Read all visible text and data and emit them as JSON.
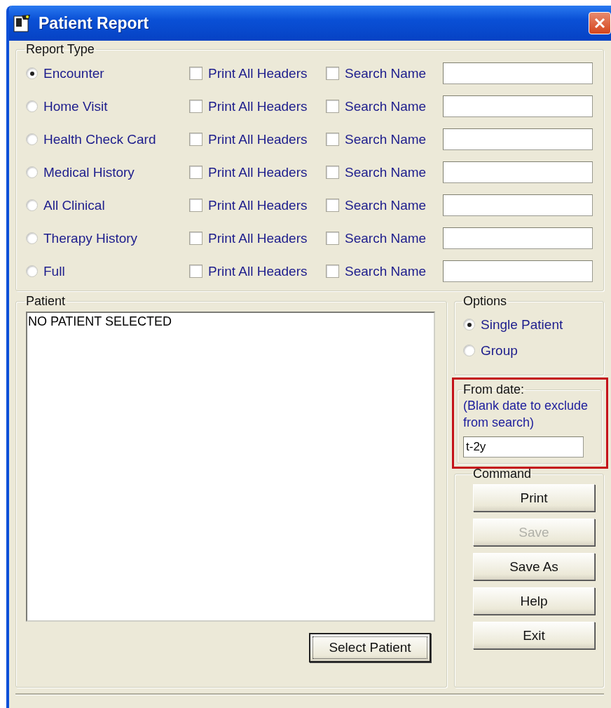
{
  "window": {
    "title": "Patient Report"
  },
  "report_type": {
    "label": "Report Type",
    "rows": [
      {
        "label": "Encounter",
        "selected": true,
        "print_all_headers": {
          "label": "Print All Headers",
          "checked": false
        },
        "search_name": {
          "label": "Search Name",
          "checked": false
        }
      },
      {
        "label": "Home Visit",
        "selected": false,
        "print_all_headers": {
          "label": "Print All Headers",
          "checked": false
        },
        "search_name": {
          "label": "Search Name",
          "checked": false
        }
      },
      {
        "label": "Health Check Card",
        "selected": false,
        "print_all_headers": {
          "label": "Print All Headers",
          "checked": false
        },
        "search_name": {
          "label": "Search Name",
          "checked": false
        }
      },
      {
        "label": "Medical History",
        "selected": false,
        "print_all_headers": {
          "label": "Print All Headers",
          "checked": false
        },
        "search_name": {
          "label": "Search Name",
          "checked": false
        }
      },
      {
        "label": "All Clinical",
        "selected": false,
        "print_all_headers": {
          "label": "Print All Headers",
          "checked": false
        },
        "search_name": {
          "label": "Search Name",
          "checked": false
        }
      },
      {
        "label": "Therapy History",
        "selected": false,
        "print_all_headers": {
          "label": "Print All Headers",
          "checked": false
        },
        "search_name": {
          "label": "Search Name",
          "checked": false
        }
      },
      {
        "label": "Full",
        "selected": false,
        "print_all_headers": {
          "label": "Print All Headers",
          "checked": false
        },
        "search_name": {
          "label": "Search Name",
          "checked": false
        }
      }
    ]
  },
  "patient": {
    "label": "Patient",
    "list": [
      "NO PATIENT SELECTED"
    ],
    "button": "Select Patient"
  },
  "options": {
    "label": "Options",
    "items": [
      {
        "label": "Single Patient",
        "selected": true
      },
      {
        "label": "Group",
        "selected": false
      }
    ]
  },
  "from_date": {
    "label": "From date:",
    "hint": "(Blank date to exclude from search)",
    "value": "t-2y",
    "highlighted": true
  },
  "command": {
    "label": "Command",
    "buttons": [
      {
        "label": "Print",
        "disabled": false
      },
      {
        "label": "Save",
        "disabled": true
      },
      {
        "label": "Save As",
        "disabled": false
      },
      {
        "label": "Help",
        "disabled": false
      },
      {
        "label": "Exit",
        "disabled": false
      }
    ]
  }
}
